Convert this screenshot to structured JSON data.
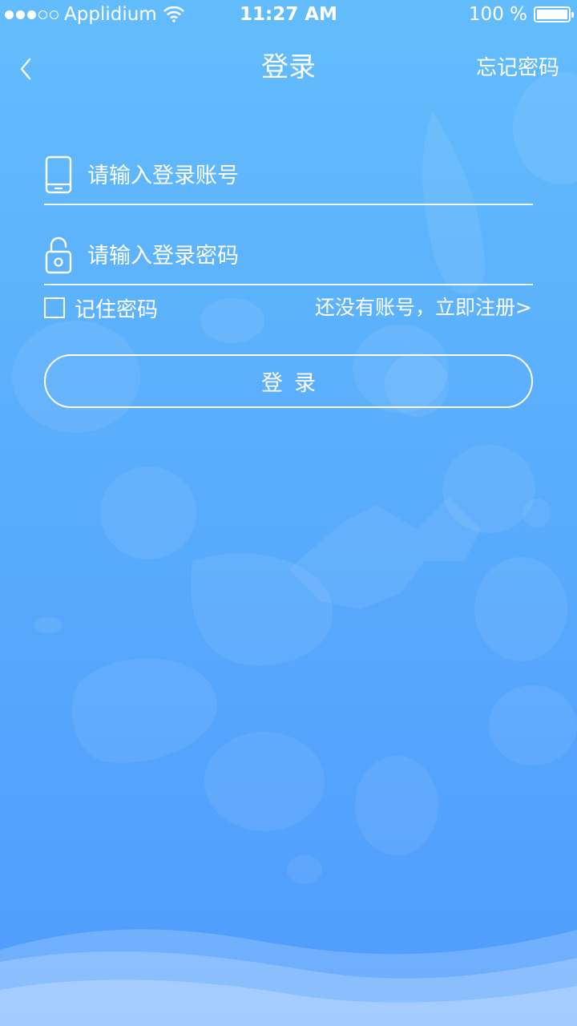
{
  "status_bar": {
    "carrier": "Applidium",
    "time": "11:27 AM",
    "battery": "100 %"
  },
  "nav": {
    "title": "登录",
    "forgot_password": "忘记密码"
  },
  "form": {
    "account_placeholder": "请输入登录账号",
    "password_placeholder": "请输入登录密码",
    "remember_label": "记住密码",
    "register_link": "还没有账号，立即注册>",
    "login_button": "登录"
  },
  "icons": {
    "back": "chevron-left-icon",
    "account": "phone-icon",
    "password": "lock-icon",
    "wifi": "wifi-icon",
    "battery": "battery-icon"
  },
  "colors": {
    "background_top": "#63bdfc",
    "background_bottom": "#4f9cfd",
    "foreground": "#ffffff"
  }
}
